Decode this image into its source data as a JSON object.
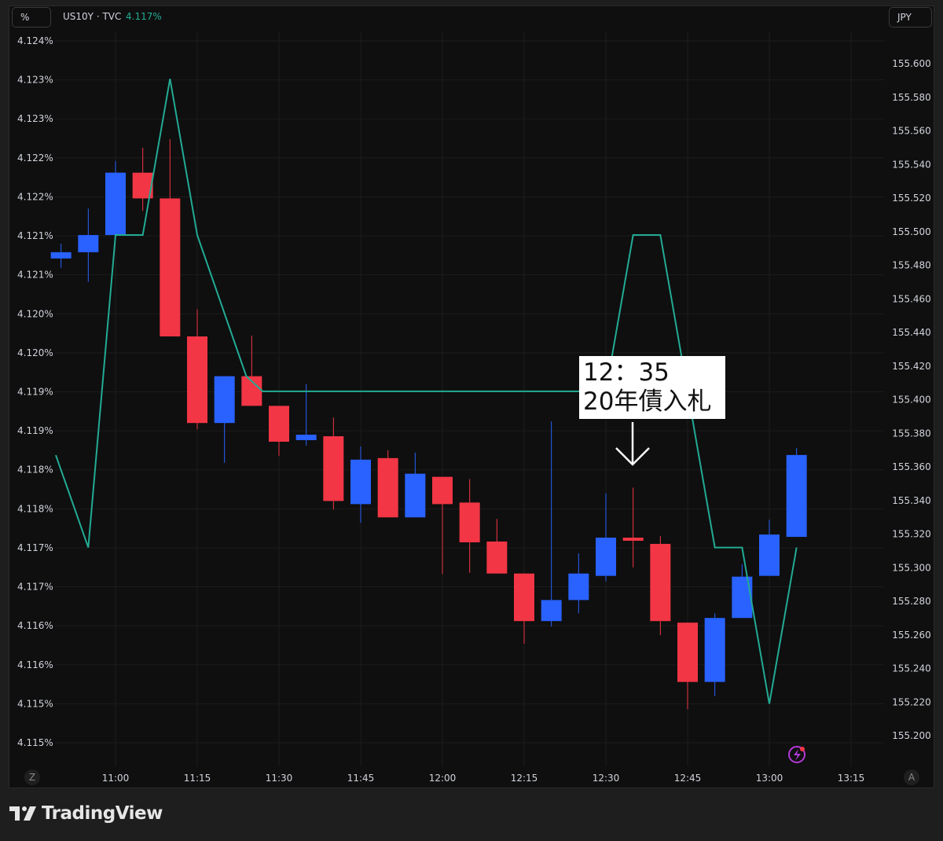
{
  "header": {
    "unit_left": "%",
    "symbol": "US10Y · TVC",
    "last_value": "4.117%",
    "unit_right": "JPY"
  },
  "annotation": {
    "line1": "12：35",
    "line2": "20年債入札",
    "icon": "arrow-down-icon"
  },
  "footer": {
    "brand": "TradingView",
    "axis_left_button": "Z",
    "axis_right_button": "A",
    "alert_icon": "lightning-icon"
  },
  "colors": {
    "up": "#2962ff",
    "down": "#f23645",
    "line": "#22ab94",
    "background": "#0f0f0f",
    "last_value": "#22ab94",
    "alert": "#b23ad6"
  },
  "chart_data": {
    "type": "candlestick+line",
    "grid": true,
    "x_ticks": [
      "11:00",
      "11:15",
      "11:30",
      "11:45",
      "12:00",
      "12:15",
      "12:30",
      "12:45",
      "13:00",
      "13:15"
    ],
    "left_axis": {
      "unit": "%",
      "range": [
        4.115,
        4.124
      ],
      "ticks": [
        "4.124%",
        "4.123%",
        "4.123%",
        "4.122%",
        "4.122%",
        "4.121%",
        "4.121%",
        "4.120%",
        "4.120%",
        "4.119%",
        "4.119%",
        "4.118%",
        "4.118%",
        "4.117%",
        "4.117%",
        "4.116%",
        "4.116%",
        "4.115%",
        "4.115%"
      ]
    },
    "right_axis": {
      "unit": "JPY",
      "range": [
        155.2,
        155.6
      ],
      "ticks": [
        "155.600",
        "155.580",
        "155.560",
        "155.540",
        "155.520",
        "155.500",
        "155.480",
        "155.460",
        "155.440",
        "155.420",
        "155.400",
        "155.380",
        "155.360",
        "155.340",
        "155.320",
        "155.300",
        "155.280",
        "155.260",
        "155.240",
        "155.220",
        "155.200"
      ]
    },
    "candles": {
      "name": "US10Y",
      "axis": "left",
      "data": [
        {
          "t": "10:50",
          "o": 4.12121,
          "h": 4.1214,
          "l": 4.12109,
          "c": 4.12129
        },
        {
          "t": "10:55",
          "o": 4.12129,
          "h": 4.12185,
          "l": 4.12091,
          "c": 4.12151
        },
        {
          "t": "11:00",
          "o": 4.12151,
          "h": 4.12246,
          "l": 4.1215,
          "c": 4.12231
        },
        {
          "t": "11:05",
          "o": 4.12231,
          "h": 4.12263,
          "l": 4.12182,
          "c": 4.12198
        },
        {
          "t": "11:10",
          "o": 4.12198,
          "h": 4.12274,
          "l": 4.12021,
          "c": 4.12021
        },
        {
          "t": "11:15",
          "o": 4.12021,
          "h": 4.12056,
          "l": 4.11902,
          "c": 4.1191
        },
        {
          "t": "11:20",
          "o": 4.1191,
          "h": 4.1197,
          "l": 4.11859,
          "c": 4.1197
        },
        {
          "t": "11:25",
          "o": 4.1197,
          "h": 4.12022,
          "l": 4.11932,
          "c": 4.11932
        },
        {
          "t": "11:30",
          "o": 4.11932,
          "h": 4.11932,
          "l": 4.11868,
          "c": 4.11886
        },
        {
          "t": "11:35",
          "o": 4.11888,
          "h": 4.1196,
          "l": 4.11881,
          "c": 4.11895
        },
        {
          "t": "11:40",
          "o": 4.11893,
          "h": 4.11917,
          "l": 4.11799,
          "c": 4.1181
        },
        {
          "t": "11:45",
          "o": 4.11806,
          "h": 4.1188,
          "l": 4.11782,
          "c": 4.11863
        },
        {
          "t": "11:50",
          "o": 4.11865,
          "h": 4.11875,
          "l": 4.11789,
          "c": 4.11789
        },
        {
          "t": "11:55",
          "o": 4.11789,
          "h": 4.11872,
          "l": 4.11789,
          "c": 4.11845
        },
        {
          "t": "12:00",
          "o": 4.11841,
          "h": 4.11841,
          "l": 4.11716,
          "c": 4.11806
        },
        {
          "t": "12:05",
          "o": 4.11808,
          "h": 4.11838,
          "l": 4.11718,
          "c": 4.11757
        },
        {
          "t": "12:10",
          "o": 4.11758,
          "h": 4.11787,
          "l": 4.11717,
          "c": 4.11717
        },
        {
          "t": "12:15",
          "o": 4.11717,
          "h": 4.11717,
          "l": 4.11627,
          "c": 4.11656
        },
        {
          "t": "12:20",
          "o": 4.11656,
          "h": 4.11912,
          "l": 4.11649,
          "c": 4.11683
        },
        {
          "t": "12:25",
          "o": 4.11683,
          "h": 4.11743,
          "l": 4.11666,
          "c": 4.11717
        },
        {
          "t": "12:30",
          "o": 4.11714,
          "h": 4.1182,
          "l": 4.11707,
          "c": 4.11763
        },
        {
          "t": "12:35",
          "o": 4.11763,
          "h": 4.11827,
          "l": 4.11725,
          "c": 4.11759
        },
        {
          "t": "12:40",
          "o": 4.11755,
          "h": 4.11765,
          "l": 4.11638,
          "c": 4.11656
        },
        {
          "t": "12:45",
          "o": 4.11654,
          "h": 4.11654,
          "l": 4.11543,
          "c": 4.11578
        },
        {
          "t": "12:50",
          "o": 4.11578,
          "h": 4.11666,
          "l": 4.1156,
          "c": 4.1166
        },
        {
          "t": "12:55",
          "o": 4.1166,
          "h": 4.11729,
          "l": 4.1166,
          "c": 4.11713
        },
        {
          "t": "13:00",
          "o": 4.11714,
          "h": 4.11786,
          "l": 4.11714,
          "c": 4.11767
        },
        {
          "t": "13:05",
          "o": 4.11764,
          "h": 4.11878,
          "l": 4.11764,
          "c": 4.11869
        }
      ]
    },
    "line": {
      "name": "JPY",
      "axis": "right",
      "points": [
        {
          "t": "10:48",
          "v": 155.367
        },
        {
          "t": "10:55",
          "v": 155.312
        },
        {
          "t": "11:00",
          "v": 155.498
        },
        {
          "t": "11:05",
          "v": 155.498
        },
        {
          "t": "11:10",
          "v": 155.591
        },
        {
          "t": "11:15",
          "v": 155.498
        },
        {
          "t": "11:24",
          "v": 155.414
        },
        {
          "t": "11:27",
          "v": 155.405
        },
        {
          "t": "12:30",
          "v": 155.405
        },
        {
          "t": "12:35",
          "v": 155.498
        },
        {
          "t": "12:40",
          "v": 155.498
        },
        {
          "t": "12:50",
          "v": 155.312
        },
        {
          "t": "12:55",
          "v": 155.312
        },
        {
          "t": "13:00",
          "v": 155.219
        },
        {
          "t": "13:05",
          "v": 155.312
        }
      ]
    }
  }
}
